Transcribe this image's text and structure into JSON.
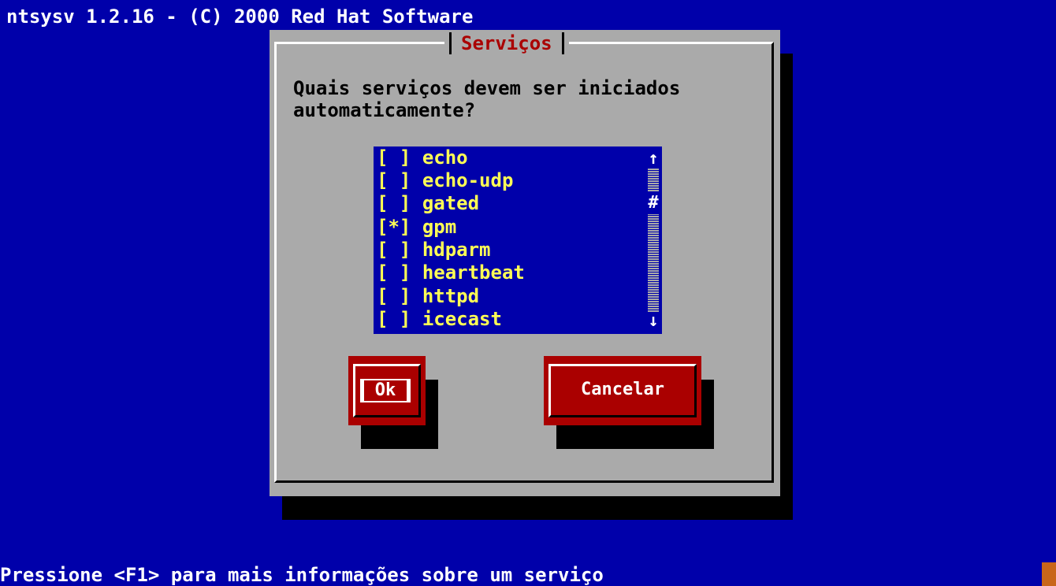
{
  "header": {
    "title": "ntsysv 1.2.16 - (C) 2000 Red Hat Software"
  },
  "dialog": {
    "title": "Serviços",
    "question": "Quais serviços devem ser iniciados\nautomaticamente?"
  },
  "services": [
    {
      "mark": "[ ]",
      "name": "echo",
      "checked": false
    },
    {
      "mark": "[ ]",
      "name": "echo-udp",
      "checked": false
    },
    {
      "mark": "[ ]",
      "name": "gated",
      "checked": false
    },
    {
      "mark": "[*]",
      "name": "gpm",
      "checked": true
    },
    {
      "mark": "[ ]",
      "name": "hdparm",
      "checked": false
    },
    {
      "mark": "[ ]",
      "name": "heartbeat",
      "checked": false
    },
    {
      "mark": "[ ]",
      "name": "httpd",
      "checked": false
    },
    {
      "mark": "[ ]",
      "name": "icecast",
      "checked": false
    }
  ],
  "scrollbar": {
    "up_arrow": "↑",
    "down_arrow": "↓",
    "thumb": "#"
  },
  "buttons": {
    "ok_label": "Ok",
    "cancel_label": "Cancelar"
  },
  "status": {
    "text": "Pressione <F1> para mais informações sobre um serviço"
  },
  "colors": {
    "background": "#0000aa",
    "dialog": "#aaaaaa",
    "accent": "#aa0000",
    "list_text": "#ffff55"
  }
}
